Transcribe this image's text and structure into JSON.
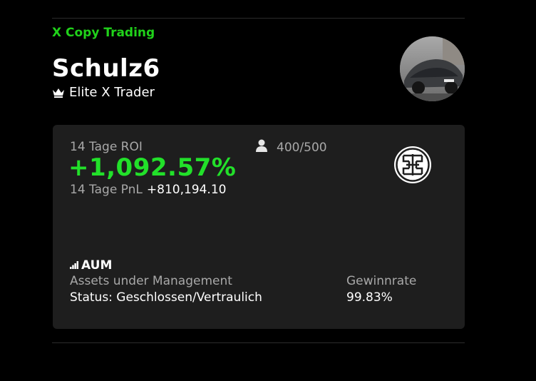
{
  "header": {
    "brand": "X Copy Trading",
    "trader_name": "Schulz6",
    "tier_label": "Elite X Trader",
    "tier_icon": "crown-icon"
  },
  "stats": {
    "roi_label": "14 Tage ROI",
    "roi_value": "+1,092.57%",
    "pnl_label": "14 Tage PnL",
    "pnl_value": "+810,194.10",
    "copiers": "400/500",
    "copiers_icon": "user-icon",
    "emblem_icon": "emblem-icon"
  },
  "aum": {
    "title": "AUM",
    "icon": "bar-chart-icon",
    "subtitle": "Assets under Management",
    "status": "Status: Geschlossen/Vertraulich"
  },
  "win_rate": {
    "label": "Gewinnrate",
    "value": "99.83%"
  },
  "colors": {
    "brand": "#20d21a",
    "roi": "#22e02a",
    "card_bg": "#1e1e1e",
    "muted_text": "#a8a8a8"
  }
}
